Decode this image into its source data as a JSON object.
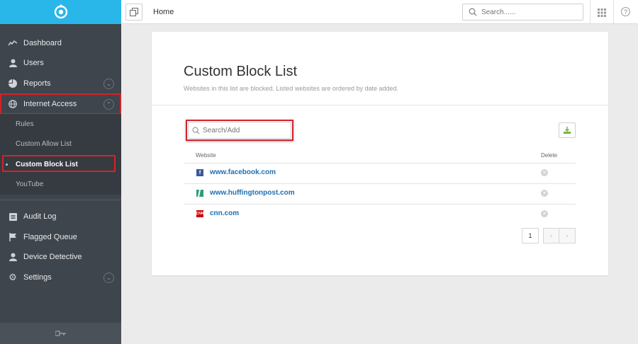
{
  "topbar": {
    "breadcrumb": "Home",
    "search_placeholder": "Search......"
  },
  "sidebar": {
    "items": [
      {
        "label": "Dashboard",
        "icon": "activity-icon"
      },
      {
        "label": "Users",
        "icon": "user-icon"
      },
      {
        "label": "Reports",
        "icon": "pie-chart-icon"
      },
      {
        "label": "Internet Access",
        "icon": "globe-icon"
      },
      {
        "label": "Audit Log",
        "icon": "list-icon"
      },
      {
        "label": "Flagged Queue",
        "icon": "flag-icon"
      },
      {
        "label": "Device Detective",
        "icon": "user-icon"
      },
      {
        "label": "Settings",
        "icon": "gear-icon"
      }
    ],
    "sub_items": [
      {
        "label": "Rules"
      },
      {
        "label": "Custom Allow List"
      },
      {
        "label": "Custom Block List",
        "active": true
      },
      {
        "label": "YouTube"
      }
    ]
  },
  "main": {
    "title": "Custom Block List",
    "subtitle": "Websites in this list are blocked. Listed websites are ordered by date added.",
    "search_placeholder": "Search/Add",
    "columns": [
      "Website",
      "Delete"
    ],
    "rows": [
      {
        "site": "www.facebook.com",
        "icon": "facebook-icon",
        "icon_color": "#3b5998",
        "icon_text": "f"
      },
      {
        "site": "www.huffingtonpost.com",
        "icon": "huffingtonpost-icon",
        "icon_color": "#2e7d6c",
        "icon_text": ""
      },
      {
        "site": "cnn.com",
        "icon": "cnn-icon",
        "icon_color": "#cc0000",
        "icon_text": "CNN"
      }
    ],
    "pagination": {
      "current": "1"
    }
  },
  "colors": {
    "accent": "#29b6e8",
    "sidebar_bg": "#3f454c",
    "highlight": "#d2232a",
    "link": "#1f6fb2"
  }
}
